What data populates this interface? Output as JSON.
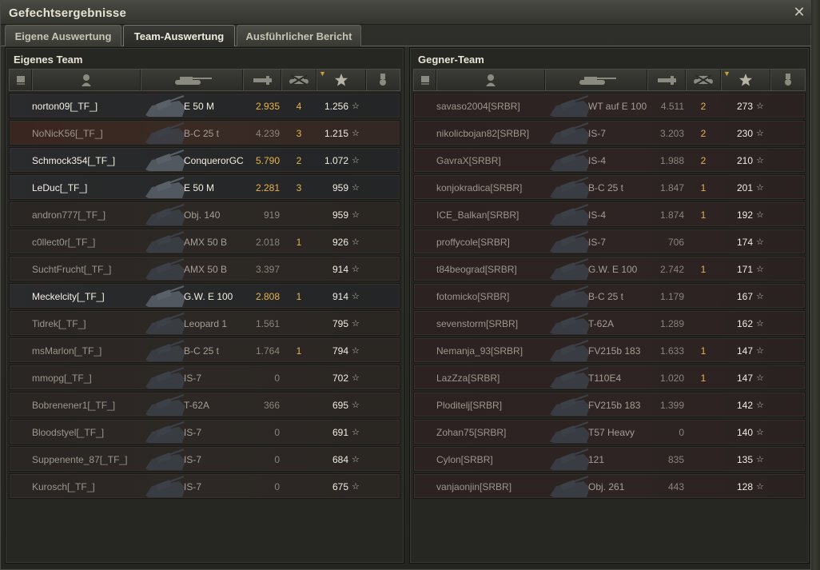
{
  "window": {
    "title": "Gefechtsergebnisse"
  },
  "tabs": [
    {
      "label": "Eigene Auswertung",
      "active": false
    },
    {
      "label": "Team-Auswertung",
      "active": true
    },
    {
      "label": "Ausführlicher Bericht",
      "active": false
    }
  ],
  "own_team": {
    "title": "Eigenes Team",
    "rows": [
      {
        "player": "norton09[_TF_]",
        "tank": "E 50 M",
        "damage": "2.935",
        "kills": "4",
        "xp": "1.256",
        "alive": true,
        "style": "alive"
      },
      {
        "player": "NoNicK56[_TF_]",
        "tank": "B-C 25 t",
        "damage": "4.239",
        "kills": "3",
        "xp": "1.215",
        "alive": false,
        "style": "highlight"
      },
      {
        "player": "Schmock354[_TF_]",
        "tank": "ConquerorGC",
        "damage": "5.790",
        "kills": "2",
        "xp": "1.072",
        "alive": true,
        "style": "alive"
      },
      {
        "player": "LeDuc[_TF_]",
        "tank": "E 50 M",
        "damage": "2.281",
        "kills": "3",
        "xp": "959",
        "alive": true,
        "style": "alive"
      },
      {
        "player": "andron777[_TF_]",
        "tank": "Obj. 140",
        "damage": "919",
        "kills": "",
        "xp": "959",
        "alive": false,
        "style": "dead"
      },
      {
        "player": "c0llect0r[_TF_]",
        "tank": "AMX 50 B",
        "damage": "2.018",
        "kills": "1",
        "xp": "926",
        "alive": false,
        "style": "dead"
      },
      {
        "player": "SuchtFrucht[_TF_]",
        "tank": "AMX 50 B",
        "damage": "3.397",
        "kills": "",
        "xp": "914",
        "alive": false,
        "style": "dead"
      },
      {
        "player": "Meckelcity[_TF_]",
        "tank": "G.W. E 100",
        "damage": "2.808",
        "kills": "1",
        "xp": "914",
        "alive": true,
        "style": "alive"
      },
      {
        "player": "Tidrek[_TF_]",
        "tank": "Leopard 1",
        "damage": "1.561",
        "kills": "",
        "xp": "795",
        "alive": false,
        "style": "dead"
      },
      {
        "player": "msMarlon[_TF_]",
        "tank": "B-C 25 t",
        "damage": "1.764",
        "kills": "1",
        "xp": "794",
        "alive": false,
        "style": "dead"
      },
      {
        "player": "mmopg[_TF_]",
        "tank": "IS-7",
        "damage": "0",
        "kills": "",
        "xp": "702",
        "alive": false,
        "style": "dead"
      },
      {
        "player": "Bobrenener1[_TF_]",
        "tank": "T-62A",
        "damage": "366",
        "kills": "",
        "xp": "695",
        "alive": false,
        "style": "dead"
      },
      {
        "player": "Bloodstyel[_TF_]",
        "tank": "IS-7",
        "damage": "0",
        "kills": "",
        "xp": "691",
        "alive": false,
        "style": "dead"
      },
      {
        "player": "Suppenente_87[_TF_]",
        "tank": "IS-7",
        "damage": "0",
        "kills": "",
        "xp": "684",
        "alive": false,
        "style": "dead"
      },
      {
        "player": "Kurosch[_TF_]",
        "tank": "IS-7",
        "damage": "0",
        "kills": "",
        "xp": "675",
        "alive": false,
        "style": "dead"
      }
    ]
  },
  "enemy_team": {
    "title": "Gegner-Team",
    "rows": [
      {
        "player": "savaso2004[SRBR]",
        "tank": "WT auf E 100",
        "damage": "4.511",
        "kills": "2",
        "xp": "273"
      },
      {
        "player": "nikolicbojan82[SRBR]",
        "tank": "IS-7",
        "damage": "3.203",
        "kills": "2",
        "xp": "230"
      },
      {
        "player": "GavraX[SRBR]",
        "tank": "IS-4",
        "damage": "1.988",
        "kills": "2",
        "xp": "210"
      },
      {
        "player": "konjokradica[SRBR]",
        "tank": "B-C 25 t",
        "damage": "1.847",
        "kills": "1",
        "xp": "201"
      },
      {
        "player": "ICE_Balkan[SRBR]",
        "tank": "IS-4",
        "damage": "1.874",
        "kills": "1",
        "xp": "192"
      },
      {
        "player": "proffycole[SRBR]",
        "tank": "IS-7",
        "damage": "706",
        "kills": "",
        "xp": "174"
      },
      {
        "player": "t84beograd[SRBR]",
        "tank": "G.W. E 100",
        "damage": "2.742",
        "kills": "1",
        "xp": "171"
      },
      {
        "player": "fotomicko[SRBR]",
        "tank": "B-C 25 t",
        "damage": "1.179",
        "kills": "",
        "xp": "167"
      },
      {
        "player": "sevenstorm[SRBR]",
        "tank": "T-62A",
        "damage": "1.289",
        "kills": "",
        "xp": "162"
      },
      {
        "player": "Nemanja_93[SRBR]",
        "tank": "FV215b 183",
        "damage": "1.633",
        "kills": "1",
        "xp": "147"
      },
      {
        "player": "LazZza[SRBR]",
        "tank": "T110E4",
        "damage": "1.020",
        "kills": "1",
        "xp": "147"
      },
      {
        "player": "Ploditelj[SRBR]",
        "tank": "FV215b 183",
        "damage": "1.399",
        "kills": "",
        "xp": "142"
      },
      {
        "player": "Zohan75[SRBR]",
        "tank": "T57 Heavy",
        "damage": "0",
        "kills": "",
        "xp": "140"
      },
      {
        "player": "Cylon[SRBR]",
        "tank": "121",
        "damage": "835",
        "kills": "",
        "xp": "135"
      },
      {
        "player": "vanjaonjin[SRBR]",
        "tank": "Obj. 261",
        "damage": "443",
        "kills": "",
        "xp": "128"
      }
    ]
  },
  "columns": [
    {
      "key": "platoon",
      "icon": "platoon-icon"
    },
    {
      "key": "player",
      "icon": "player-icon"
    },
    {
      "key": "tank",
      "icon": "tank-icon"
    },
    {
      "key": "damage",
      "icon": "damage-icon"
    },
    {
      "key": "kills",
      "icon": "kills-icon"
    },
    {
      "key": "xp",
      "icon": "xp-star-icon"
    },
    {
      "key": "medals",
      "icon": "medal-icon"
    }
  ],
  "colors": {
    "accent": "#e8b44a",
    "alive_text": "#f4f0e6",
    "dead_text": "#9e968c"
  }
}
